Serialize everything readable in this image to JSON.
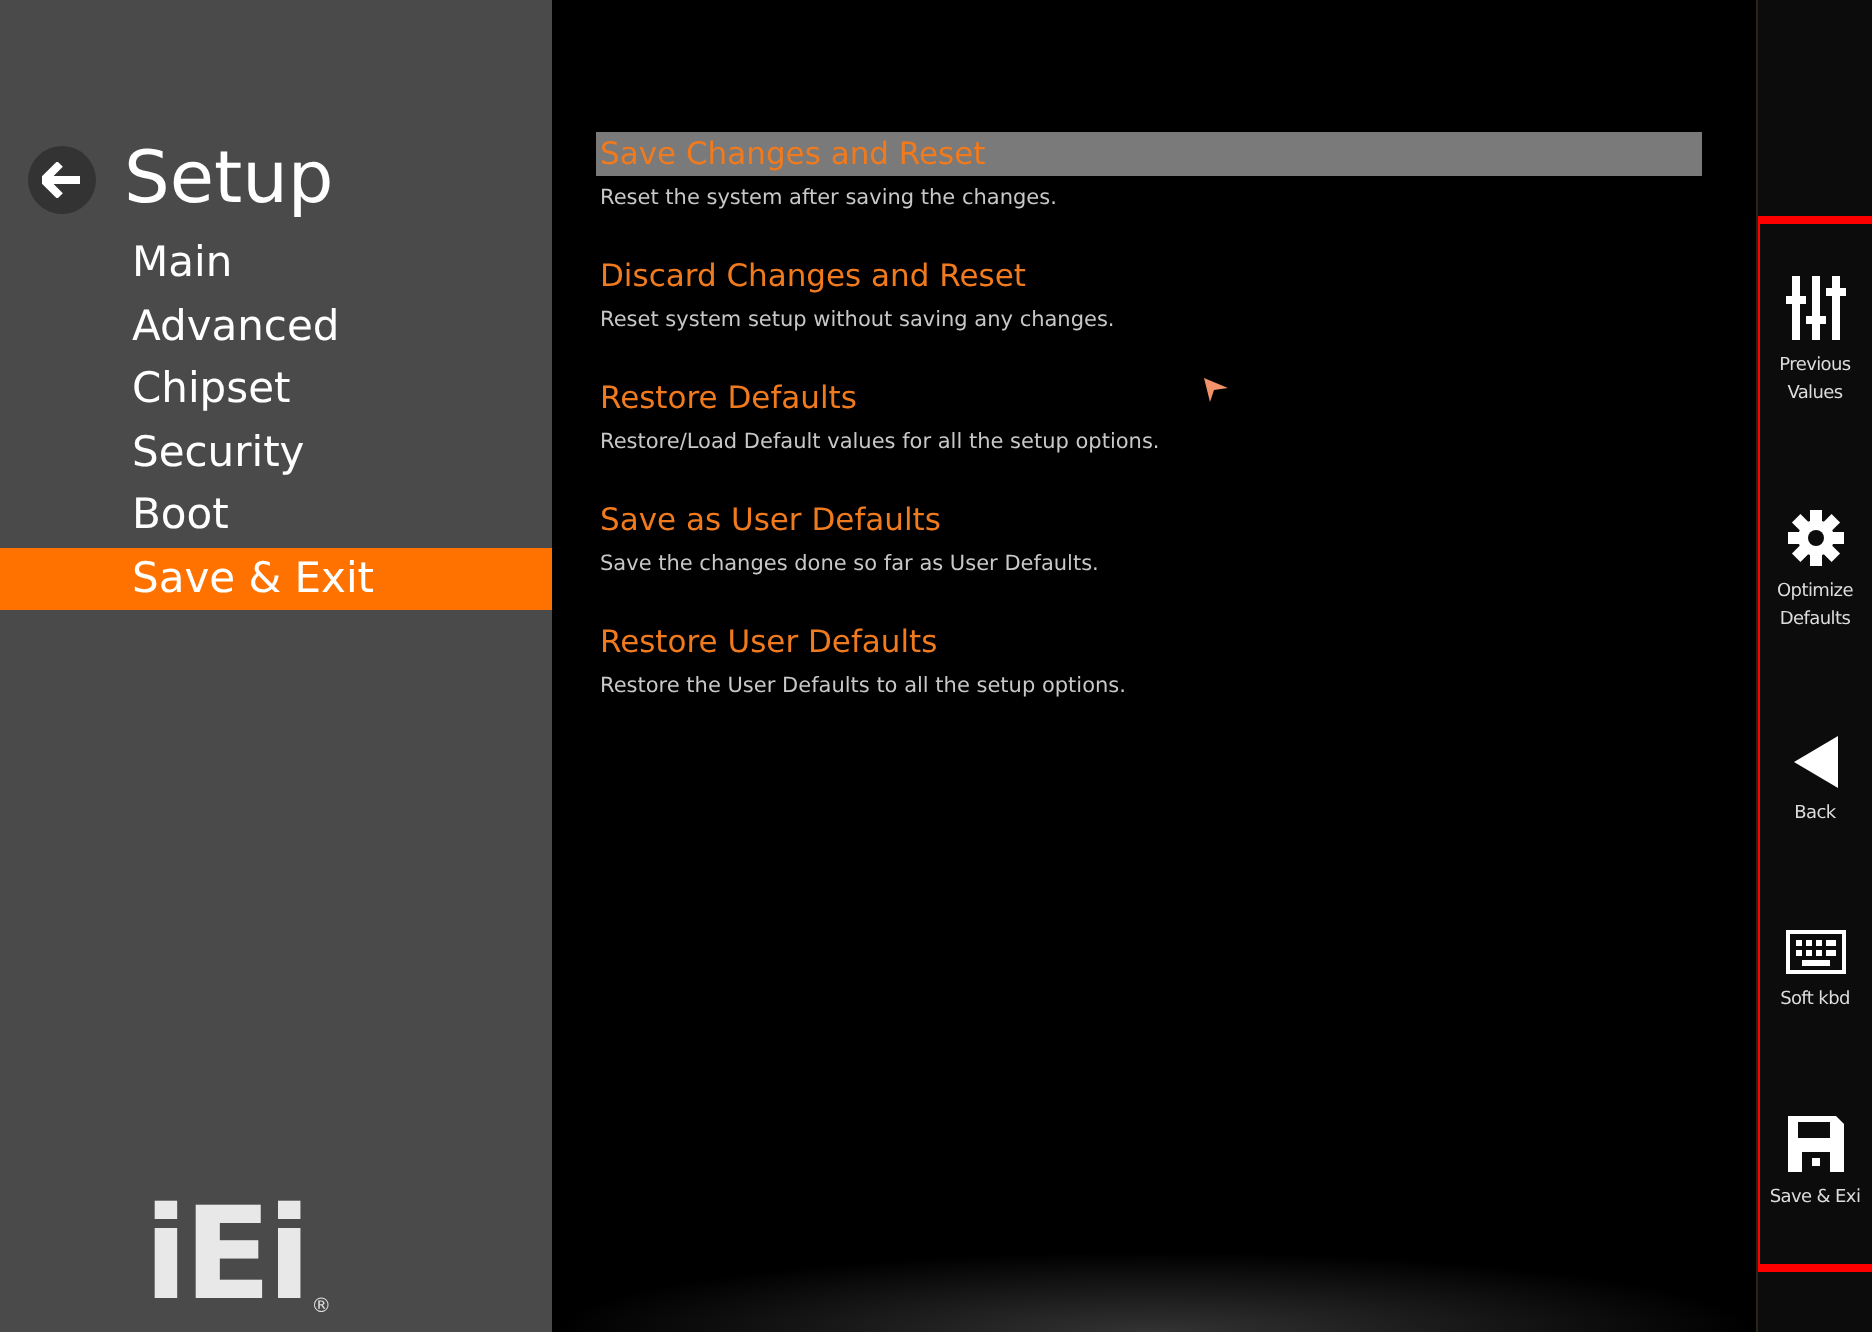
{
  "sidebar": {
    "title": "Setup",
    "items": [
      {
        "label": "Main",
        "selected": false
      },
      {
        "label": "Advanced",
        "selected": false
      },
      {
        "label": "Chipset",
        "selected": false
      },
      {
        "label": "Security",
        "selected": false
      },
      {
        "label": "Boot",
        "selected": false
      },
      {
        "label": "Save & Exit",
        "selected": true
      }
    ],
    "logo": {
      "text": "iEi",
      "mark": "®"
    }
  },
  "options": [
    {
      "title": "Save Changes and Reset",
      "description": "Reset the system after saving the changes.",
      "selected": true
    },
    {
      "title": "Discard Changes and Reset",
      "description": "Reset system setup without saving any changes.",
      "selected": false
    },
    {
      "title": "Restore Defaults",
      "description": "Restore/Load Default values for all the setup options.",
      "selected": false
    },
    {
      "title": "Save as User Defaults",
      "description": "Save the changes done so far as User Defaults.",
      "selected": false
    },
    {
      "title": "Restore User Defaults",
      "description": "Restore the User Defaults to all the setup options.",
      "selected": false
    }
  ],
  "action_bar": [
    {
      "kind": "sliders",
      "label": [
        "Previous",
        "Values"
      ]
    },
    {
      "kind": "gear",
      "label": [
        "Optimize",
        "Defaults"
      ]
    },
    {
      "kind": "back",
      "label": [
        "Back"
      ]
    },
    {
      "kind": "keyboard",
      "label": [
        "Soft kbd"
      ]
    },
    {
      "kind": "save",
      "label": [
        "Save & Exi"
      ]
    }
  ]
}
